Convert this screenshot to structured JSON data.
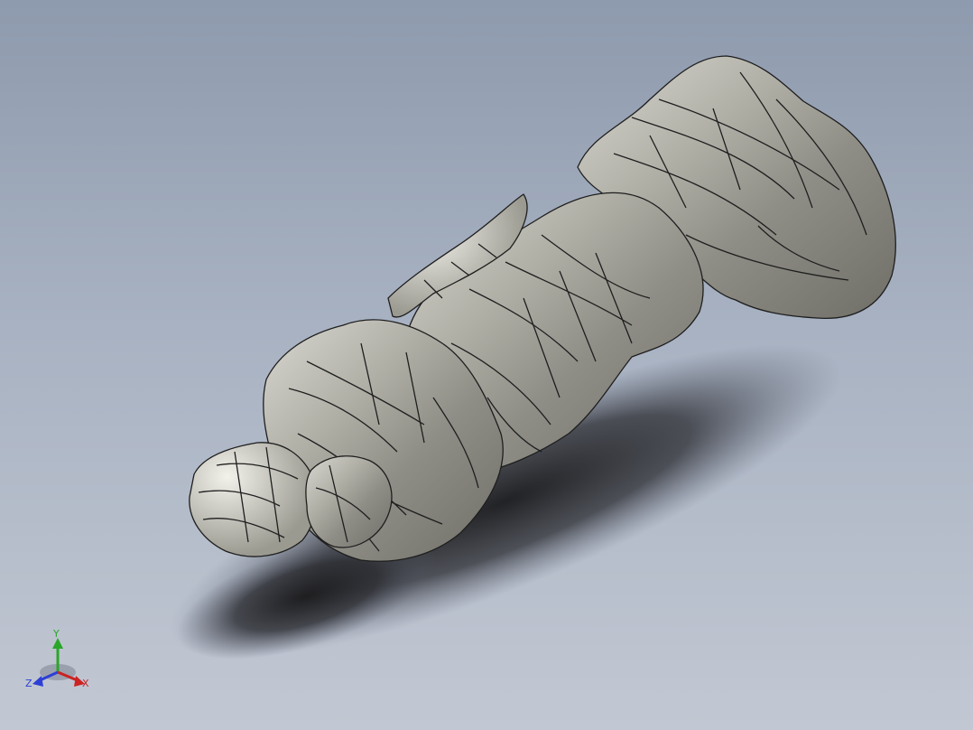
{
  "viewport": {
    "background_top": "#8e9aad",
    "background_bottom": "#c2c8d3",
    "model": {
      "icon": "cast-statue-model-icon",
      "surface_color": "#a9a89e",
      "edge_color": "#1e1e1e"
    }
  },
  "triad": {
    "x_label": "X",
    "y_label": "Y",
    "z_label": "Z",
    "x_color": "#cc2222",
    "y_color": "#2aa62a",
    "z_color": "#2d3fd6"
  }
}
